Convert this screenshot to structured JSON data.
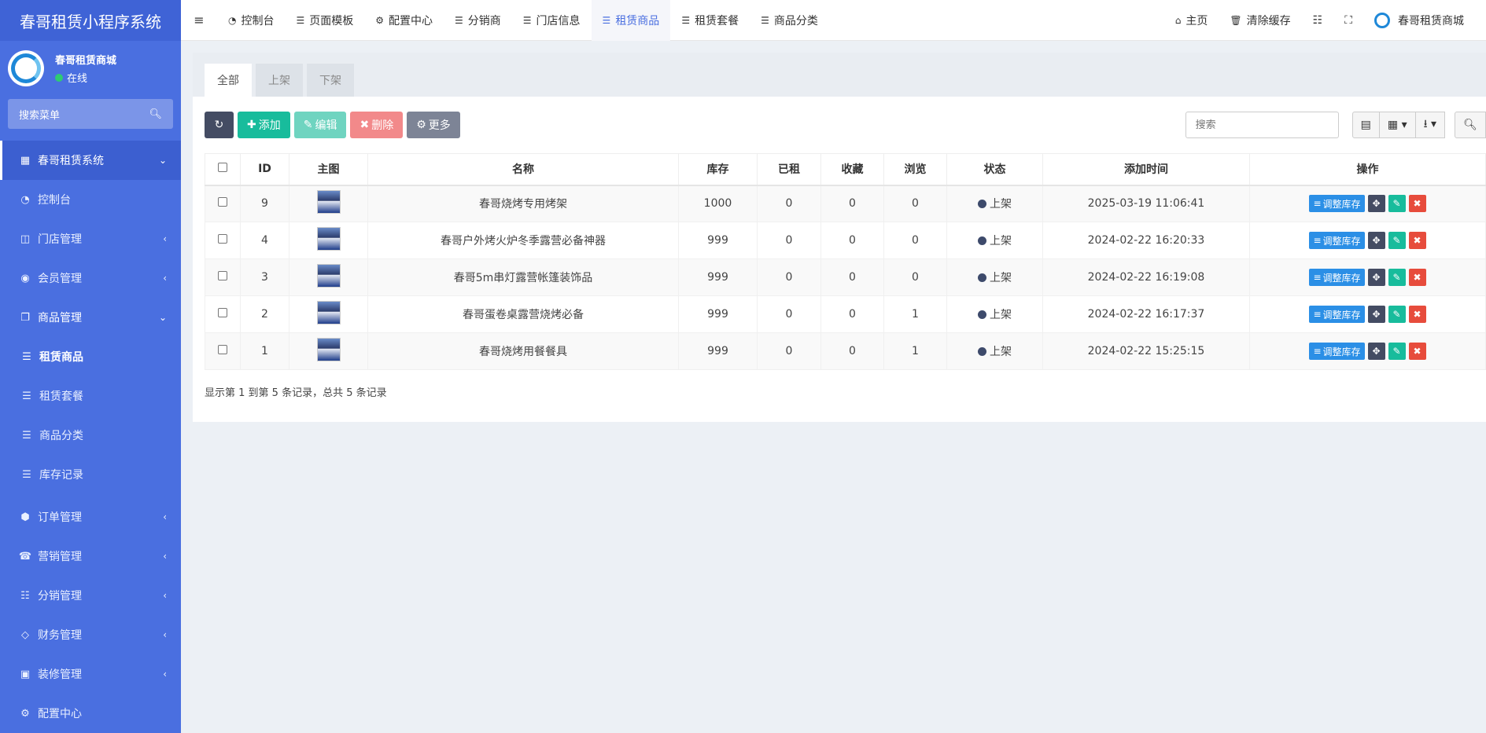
{
  "sidebar": {
    "brand": "春哥租赁小程序系统",
    "user_name": "春哥租赁商城",
    "user_status": "在线",
    "search_placeholder": "搜索菜单",
    "menu": [
      {
        "label": "春哥租赁系统",
        "icon": "grid-icon"
      },
      {
        "label": "控制台",
        "icon": "dashboard-icon"
      },
      {
        "label": "门店管理",
        "icon": "store-icon"
      },
      {
        "label": "会员管理",
        "icon": "user-icon"
      },
      {
        "label": "商品管理",
        "icon": "goods-icon"
      },
      {
        "label": "租赁商品",
        "icon": "list-icon"
      },
      {
        "label": "租赁套餐",
        "icon": "list-icon"
      },
      {
        "label": "商品分类",
        "icon": "list-icon"
      },
      {
        "label": "库存记录",
        "icon": "list-icon"
      },
      {
        "label": "订单管理",
        "icon": "cube-icon"
      },
      {
        "label": "营销管理",
        "icon": "phone-icon"
      },
      {
        "label": "分销管理",
        "icon": "sitemap-icon"
      },
      {
        "label": "财务管理",
        "icon": "diamond-icon"
      },
      {
        "label": "装修管理",
        "icon": "image-icon"
      },
      {
        "label": "配置中心",
        "icon": "gear-icon"
      }
    ]
  },
  "topnav": {
    "items": [
      "控制台",
      "页面模板",
      "配置中心",
      "分销商",
      "门店信息",
      "租赁商品",
      "租赁套餐",
      "商品分类"
    ],
    "home": "主页",
    "clear_cache": "清除缓存",
    "shop_name": "春哥租赁商城"
  },
  "tabs": [
    "全部",
    "上架",
    "下架"
  ],
  "toolbar": {
    "add": "添加",
    "edit": "编辑",
    "delete": "删除",
    "more": "更多",
    "search_placeholder": "搜索"
  },
  "table": {
    "headers": [
      "ID",
      "主图",
      "名称",
      "库存",
      "已租",
      "收藏",
      "浏览",
      "状态",
      "添加时间",
      "操作"
    ],
    "rows": [
      {
        "id": "9",
        "name": "春哥烧烤专用烤架",
        "stock": "1000",
        "rented": "0",
        "fav": "0",
        "views": "0",
        "status": "上架",
        "time": "2025-03-19 11:06:41"
      },
      {
        "id": "4",
        "name": "春哥户外烤火炉冬季露营必备神器",
        "stock": "999",
        "rented": "0",
        "fav": "0",
        "views": "0",
        "status": "上架",
        "time": "2024-02-22 16:20:33"
      },
      {
        "id": "3",
        "name": "春哥5m串灯露营帐篷装饰品",
        "stock": "999",
        "rented": "0",
        "fav": "0",
        "views": "0",
        "status": "上架",
        "time": "2024-02-22 16:19:08"
      },
      {
        "id": "2",
        "name": "春哥蛋卷桌露营烧烤必备",
        "stock": "999",
        "rented": "0",
        "fav": "0",
        "views": "1",
        "status": "上架",
        "time": "2024-02-22 16:17:37"
      },
      {
        "id": "1",
        "name": "春哥烧烤用餐餐具",
        "stock": "999",
        "rented": "0",
        "fav": "0",
        "views": "1",
        "status": "上架",
        "time": "2024-02-22 15:25:15"
      }
    ],
    "adjust_stock": "调整库存"
  },
  "pagination": "显示第 1 到第 5 条记录，总共 5 条记录"
}
